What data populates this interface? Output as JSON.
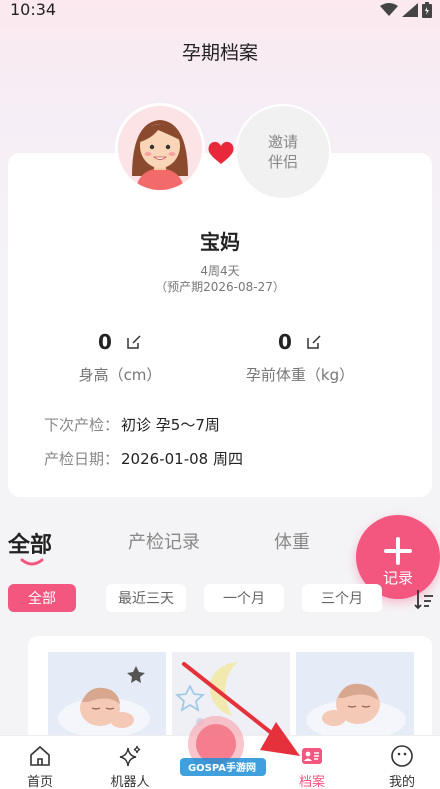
{
  "status": {
    "time": "10:34"
  },
  "page": {
    "title": "孕期档案"
  },
  "profile": {
    "invite_line1": "邀请",
    "invite_line2": "伴侣",
    "name": "宝妈",
    "weeks": "4周4天",
    "due_date": "（预产期2026-08-27）",
    "height_value": "0",
    "height_label": "身高（cm）",
    "weight_value": "0",
    "weight_label": "孕前体重（kg）",
    "next_checkup_label": "下次产检：",
    "next_checkup_value": "初诊 孕5～7周",
    "checkup_date_label": "产检日期：",
    "checkup_date_value": "2026-01-08 周四"
  },
  "tabs": [
    {
      "label": "全部",
      "active": true
    },
    {
      "label": "产检记录",
      "active": false
    },
    {
      "label": "体重",
      "active": false
    }
  ],
  "fab": {
    "label": "记录"
  },
  "filters": [
    {
      "label": "全部",
      "active": true
    },
    {
      "label": "最近三天",
      "active": false
    },
    {
      "label": "一个月",
      "active": false
    },
    {
      "label": "三个月",
      "active": false
    }
  ],
  "bottom_nav": [
    {
      "label": "首页",
      "icon": "home-icon"
    },
    {
      "label": "机器人",
      "icon": "sparkle-icon"
    },
    {
      "label": "档案",
      "icon": "archive-icon",
      "active": true
    },
    {
      "label": "我的",
      "icon": "smile-icon"
    }
  ],
  "colors": {
    "accent": "#f3567e",
    "background": "#f4f4f6",
    "card": "#ffffff"
  },
  "watermark": {
    "text": "GOSPA手游网"
  }
}
